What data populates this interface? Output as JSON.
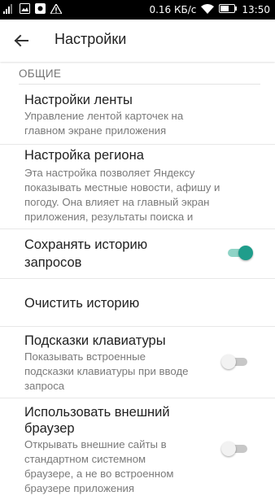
{
  "status_bar": {
    "speed": "0.16 КБ/с",
    "time": "13:50",
    "icons": [
      "signal-bars-icon",
      "image-icon",
      "shield-app-icon",
      "warning-icon",
      "wifi-icon",
      "battery-icon"
    ]
  },
  "app_bar": {
    "title": "Настройки",
    "back_icon": "arrow-left-icon"
  },
  "section": {
    "title": "ОБЩИЕ"
  },
  "items": [
    {
      "title": "Настройки ленты",
      "subtitle_lines": [
        "Управление лентой карточек на",
        "главном экране приложения"
      ]
    },
    {
      "title": "Настройка региона",
      "subtitle_lines": [
        "Эта настройка позволяет Яндексу",
        "показывать местные новости, афишу и",
        "погоду. Она влияет на главный экран",
        "приложения, результаты поиска и"
      ]
    },
    {
      "title_lines": [
        "Сохранять историю",
        "запросов"
      ],
      "toggle": true
    },
    {
      "title": "Очистить историю"
    },
    {
      "title": "Подсказки клавиатуры",
      "subtitle_lines": [
        "Показывать встроенные",
        "подсказки клавиатуры при вводе",
        "запроса"
      ],
      "toggle": false
    },
    {
      "title_lines": [
        "Использовать внешний",
        "браузер"
      ],
      "subtitle_lines": [
        "Открывать внешние сайты в",
        "стандартном системном",
        "браузере, а не во встроенном",
        "браузере приложения"
      ],
      "toggle": false
    }
  ],
  "colors": {
    "accent": "#1f9d8b",
    "accent_track": "#8fd3c6",
    "off_track": "#c7c7c7"
  }
}
